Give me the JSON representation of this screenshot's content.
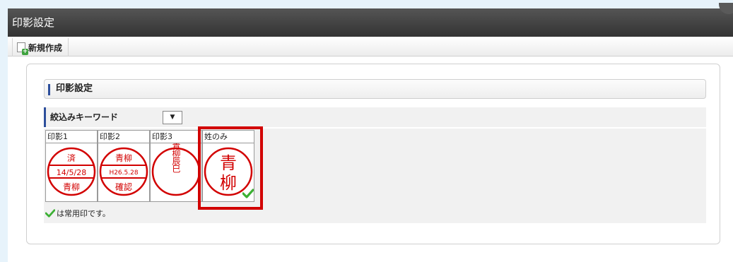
{
  "window": {
    "title": "印影設定"
  },
  "toolbar": {
    "new_label": "新規作成"
  },
  "section": {
    "title": "印影設定"
  },
  "filter": {
    "label": "絞込みキーワード",
    "select_value": "▼"
  },
  "stamps": [
    {
      "header": "印影1",
      "top": "済",
      "middle": "14/5/28",
      "bottom": "青柳"
    },
    {
      "header": "印影2",
      "top": "青柳",
      "middle": "H26.5.28",
      "bottom": "確認"
    },
    {
      "header": "印影3",
      "text": "青柳辰巳"
    },
    {
      "header": "姓のみ",
      "line1": "青",
      "line2": "柳",
      "frequent": true
    }
  ],
  "note": {
    "text": "は常用印です。"
  },
  "colors": {
    "stamp_red": "#d20000",
    "accent_blue": "#2d4f9c",
    "check_green": "#3cb034"
  }
}
